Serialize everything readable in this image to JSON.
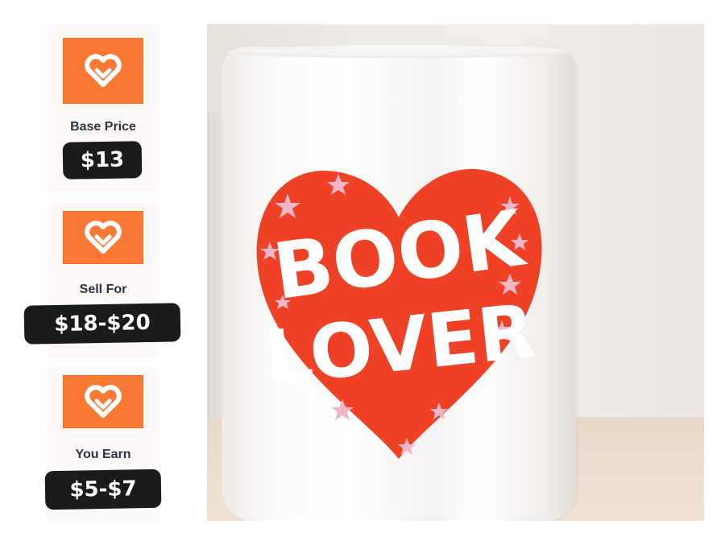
{
  "cards": {
    "base": {
      "label": "Base Price",
      "price": "$13",
      "icon": "heart-outline-icon"
    },
    "sell": {
      "label": "Sell For",
      "price": "$18-$20",
      "icon": "heart-outline-icon"
    },
    "earn": {
      "label": "You Earn",
      "price": "$5-$7",
      "icon": "heart-outline-icon"
    }
  },
  "product": {
    "image": "mug-photo",
    "print_lines": [
      "BOOK",
      "LOVER"
    ]
  },
  "colors": {
    "accent": "#fa7a35",
    "price_bg": "#1b1b1b",
    "label_text": "#2d3445",
    "heart_red": "#ef4126",
    "star_pink": "#f3b6c8"
  }
}
